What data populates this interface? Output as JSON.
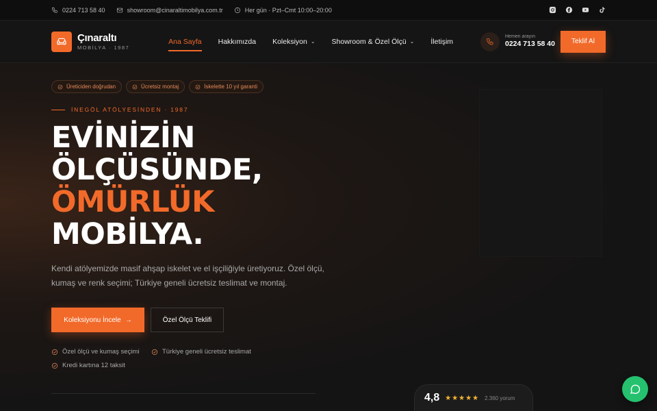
{
  "topbar": {
    "phone": "0224 713 58 40",
    "email": "showroom@cinaraltimobilya.com.tr",
    "hours": "Her gün · Pzt–Cmt 10:00–20:00",
    "socials": [
      "instagram-icon",
      "facebook-icon",
      "youtube-icon",
      "tiktok-icon"
    ]
  },
  "brand": {
    "name": "Çınaraltı",
    "sub": "MOBİLYA · 1987",
    "accent": "#f26a2a"
  },
  "nav": {
    "items": [
      {
        "label": "Ana Sayfa",
        "active": true
      },
      {
        "label": "Hakkımızda"
      },
      {
        "label": "Koleksiyon",
        "dropdown": true
      },
      {
        "label": "Showroom & Özel Ölçü",
        "dropdown": true
      },
      {
        "label": "İletişim"
      }
    ],
    "call_small": "Hemen arayın",
    "call_number": "0224 713 58 40",
    "cta": "Teklif Al"
  },
  "hero": {
    "badges": [
      "Üreticiden doğrudan",
      "Ücretsiz montaj",
      "İskelette 10 yıl garanti"
    ],
    "eyebrow": "İNEGÖL ATÖLYESİNDEN · 1987",
    "headline": [
      "EVİNİZİN",
      "ÖLÇÜSÜNDE,",
      "ÖMÜRLÜK",
      "MOBİLYA."
    ],
    "description": "Kendi atölyemizde masif ahşap iskelet ve el işçiliğiyle üretiyoruz. Özel ölçü, kumaş ve renk seçimi; Türkiye geneli ücretsiz teslimat ve montaj.",
    "primary_btn": "Koleksiyonu İncele",
    "secondary_btn": "Özel Ölçü Teklifi",
    "features": [
      "Özel ölçü ve kumaş seçimi",
      "Türkiye geneli ücretsiz teslimat",
      "Kredi kartına 12 taksit"
    ]
  },
  "rating": {
    "value": "4,8",
    "stars": "★★★★★",
    "count": "2.360 yorum"
  }
}
